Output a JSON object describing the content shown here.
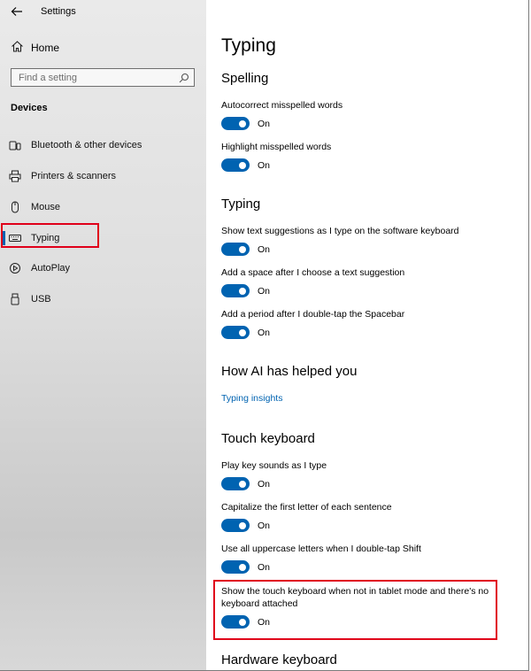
{
  "window": {
    "title": "Settings"
  },
  "sidebar": {
    "home_label": "Home",
    "search_placeholder": "Find a setting",
    "section": "Devices",
    "items": [
      {
        "label": "Bluetooth & other devices",
        "icon": "bluetooth-icon"
      },
      {
        "label": "Printers & scanners",
        "icon": "printer-icon"
      },
      {
        "label": "Mouse",
        "icon": "mouse-icon"
      },
      {
        "label": "Typing",
        "icon": "keyboard-icon",
        "selected": true
      },
      {
        "label": "AutoPlay",
        "icon": "autoplay-icon"
      },
      {
        "label": "USB",
        "icon": "usb-icon"
      }
    ]
  },
  "main": {
    "title": "Typing",
    "spelling": {
      "heading": "Spelling",
      "autocorrect": {
        "label": "Autocorrect misspelled words",
        "state": "On"
      },
      "highlight": {
        "label": "Highlight misspelled words",
        "state": "On"
      }
    },
    "typing": {
      "heading": "Typing",
      "suggestions": {
        "label": "Show text suggestions as I type on the software keyboard",
        "state": "On"
      },
      "space": {
        "label": "Add a space after I choose a text suggestion",
        "state": "On"
      },
      "period": {
        "label": "Add a period after I double-tap the Spacebar",
        "state": "On"
      }
    },
    "ai": {
      "heading": "How AI has helped you",
      "link": "Typing insights"
    },
    "touch": {
      "heading": "Touch keyboard",
      "sounds": {
        "label": "Play key sounds as I type",
        "state": "On"
      },
      "capitalize": {
        "label": "Capitalize the first letter of each sentence",
        "state": "On"
      },
      "uppercase": {
        "label": "Use all uppercase letters when I double-tap Shift",
        "state": "On"
      },
      "show_keyboard": {
        "label_line1": "Show the touch keyboard when not in tablet mode and there's no",
        "label_line2": "keyboard attached",
        "state": "On"
      }
    },
    "hardware": {
      "heading": "Hardware keyboard"
    }
  },
  "colors": {
    "accent": "#0063b1",
    "highlight_box": "#e0001a"
  }
}
